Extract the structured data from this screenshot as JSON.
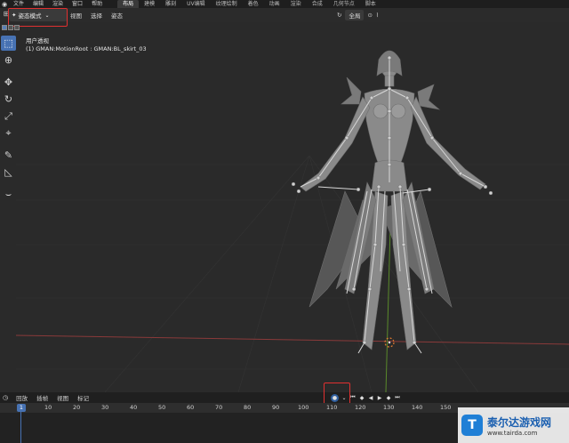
{
  "topbar": {
    "menu": [
      "文件",
      "编辑",
      "渲染",
      "窗口",
      "帮助"
    ],
    "workspaces": [
      "布局",
      "建模",
      "雕刻",
      "UV编辑",
      "纹理绘制",
      "着色",
      "动画",
      "渲染",
      "合成",
      "几何节点",
      "脚本"
    ],
    "active_workspace": "布局"
  },
  "viewport_header": {
    "mode": "姿态模式",
    "menu": [
      "视图",
      "选择",
      "姿态"
    ],
    "orientation": "全局"
  },
  "viewport": {
    "view_name": "用户透视",
    "object_info": "(1) GMAN:MotionRoot : GMAN:BL_skirt_03"
  },
  "toolbar": {
    "tools": [
      "select-box",
      "cursor",
      "move",
      "rotate",
      "scale",
      "transform",
      "annotate",
      "measure",
      "relax-pose"
    ]
  },
  "timeline": {
    "menu": [
      "回放",
      "插帧",
      "视图",
      "标记"
    ],
    "current_frame": "1",
    "ticks": [
      "10",
      "20",
      "30",
      "40",
      "50",
      "60",
      "70",
      "80",
      "90",
      "100",
      "110",
      "120",
      "130",
      "140",
      "150"
    ]
  },
  "watermark": {
    "title": "泰尔达游戏网",
    "url": "www.tairda.com",
    "logo_letter": "T"
  },
  "colors": {
    "accent": "#4772b3",
    "highlight_box": "#e03030",
    "x_axis": "#8a3a3a",
    "y_axis": "#5a8a2a"
  }
}
